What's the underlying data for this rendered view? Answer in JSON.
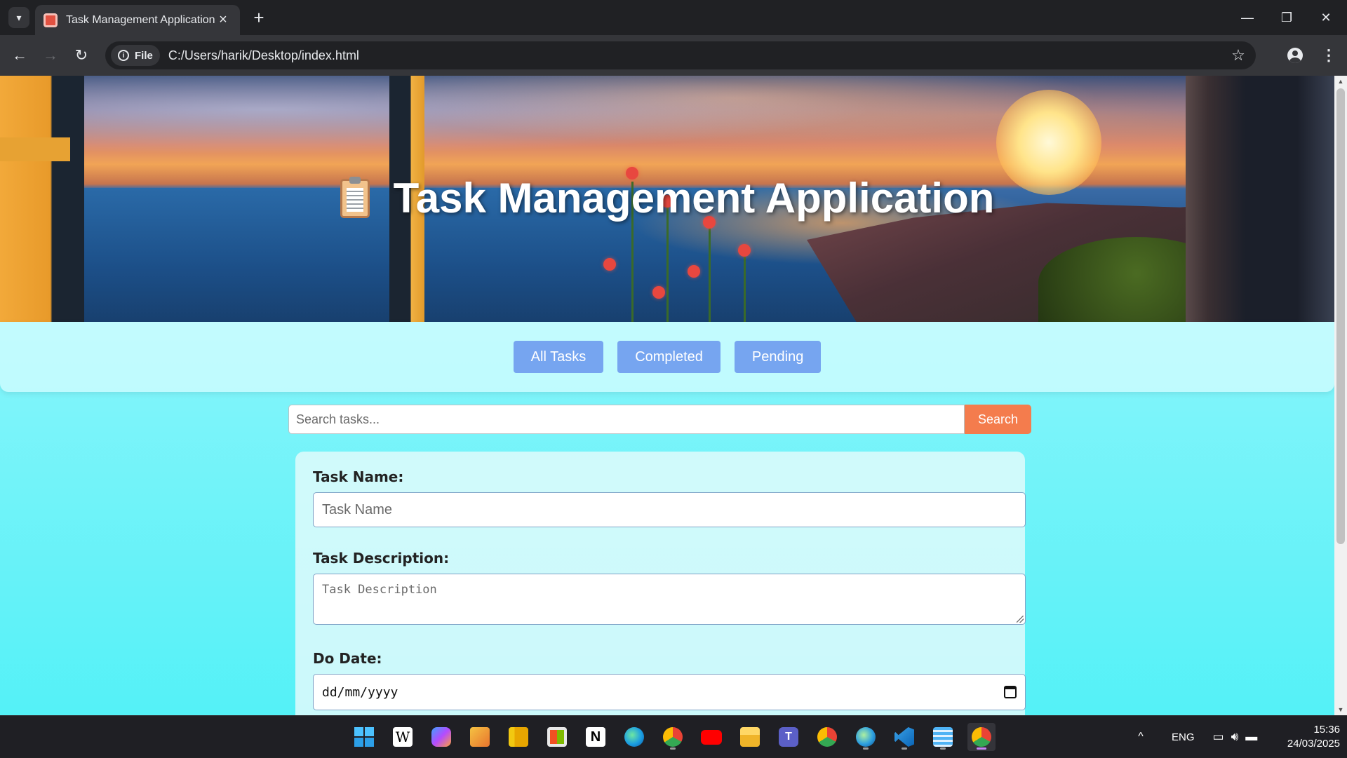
{
  "browser": {
    "tab_title": "Task Management Application",
    "url_chip": "File",
    "url": "C:/Users/harik/Desktop/index.html"
  },
  "page": {
    "title": "Task Management Application",
    "filters": [
      "All Tasks",
      "Completed",
      "Pending"
    ],
    "search": {
      "placeholder": "Search tasks...",
      "button_label": "Search"
    },
    "form": {
      "task_name_label": "Task Name:",
      "task_name_placeholder": "Task Name",
      "task_description_label": "Task Description:",
      "task_description_placeholder": "Task Description",
      "do_date_label": "Do Date:",
      "do_date_placeholder": "dd/mm/yyyy"
    }
  },
  "taskbar": {
    "apps": [
      "start-icon",
      "wikipedia-icon",
      "copilot-icon",
      "snipping-tool-icon",
      "power-bi-icon",
      "microsoft-store-icon",
      "notion-icon",
      "edge-icon",
      "chrome-profile-icon",
      "youtube-icon",
      "file-explorer-icon",
      "teams-icon",
      "chrome-icon",
      "edge-dev-icon",
      "vscode-icon",
      "notepad-icon",
      "chrome-active-icon"
    ],
    "language": "ENG",
    "time": "15:36",
    "date": "24/03/2025"
  }
}
